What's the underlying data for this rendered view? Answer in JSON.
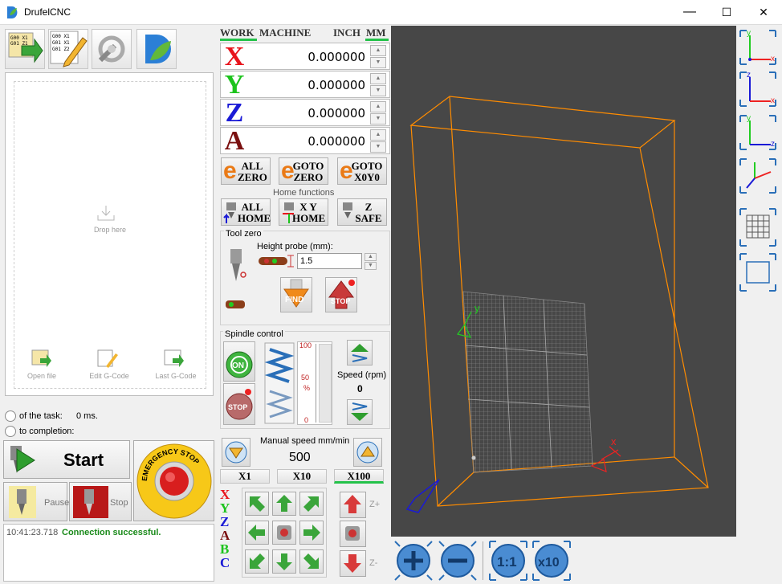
{
  "window": {
    "title": "DrufelCNC",
    "minimize": "—",
    "maximize": "☐",
    "close": "✕"
  },
  "toolbar": {
    "open_icon": "open-gcode-icon",
    "edit_icon": "edit-gcode-icon",
    "settings_icon": "settings-wrench-icon",
    "logo_icon": "drufel-logo-icon"
  },
  "files": {
    "drop_label": "Drop here",
    "open_label": "Open file",
    "edit_label": "Edit G-Code",
    "last_label": "Last G-Code"
  },
  "task": {
    "duration_label": "of the task:",
    "duration_value": "0 ms.",
    "completion_label": "to completion:"
  },
  "controls": {
    "start_label": "Start",
    "pause_label": "Pause",
    "stop_label": "Stop",
    "estop_label": "EMERGENCY STOP"
  },
  "log": {
    "time": "10:41:23.718",
    "message": "Connection successful."
  },
  "coords": {
    "tab_work": "WORK",
    "tab_machine": "MACHINE",
    "unit_inch": "INCH",
    "unit_mm": "MM",
    "active_tab": "WORK",
    "active_unit": "MM",
    "axes": [
      {
        "letter": "X",
        "value": "0.000000",
        "color": "#e8141c"
      },
      {
        "letter": "Y",
        "value": "0.000000",
        "color": "#1cc31c"
      },
      {
        "letter": "Z",
        "value": "0.000000",
        "color": "#1a1ad6"
      },
      {
        "letter": "A",
        "value": "0.000000",
        "color": "#7a1010"
      }
    ]
  },
  "zero": {
    "all_zero": "ALL ZERO",
    "goto_zero": "GOTO ZERO",
    "goto_x0y0": "GOTO X0Y0"
  },
  "home": {
    "title": "Home functions",
    "all_home": "ALL HOME",
    "xy_home": "X Y HOME",
    "z_safe": "Z SAFE"
  },
  "toolzero": {
    "title": "Tool zero",
    "probe_label": "Height probe (mm):",
    "probe_value": "1.5",
    "find_label": "FIND",
    "stop_label": "STOP"
  },
  "spindle": {
    "title": "Spindle control",
    "on_label": "ON",
    "stop_label": "STOP",
    "scale_max": "100",
    "scale_mid": "50",
    "scale_unit": "%",
    "scale_min": "0",
    "speed_label": "Speed (rpm)",
    "speed_value": "0"
  },
  "manual": {
    "title": "Manual speed mm/min",
    "speed": "500",
    "mult": [
      "X1",
      "X10",
      "X100"
    ],
    "active_mult": "X100"
  },
  "jog": {
    "axes": [
      {
        "l": "X",
        "c": "#e8141c"
      },
      {
        "l": "Y",
        "c": "#1cc31c"
      },
      {
        "l": "Z",
        "c": "#1a1ad6"
      },
      {
        "l": "A",
        "c": "#7a1010"
      },
      {
        "l": "B",
        "c": "#1cc31c"
      },
      {
        "l": "C",
        "c": "#1a1ad6"
      }
    ],
    "zplus": "Z+",
    "zminus": "Z-"
  },
  "viewport": {
    "bg": "#474747",
    "box_color": "#ff8c00",
    "axis_y": "y",
    "axis_x": "x"
  },
  "viewbuttons": {
    "zoom_in": "+",
    "zoom_out": "−",
    "fit": "1:1",
    "x10": "x10"
  }
}
